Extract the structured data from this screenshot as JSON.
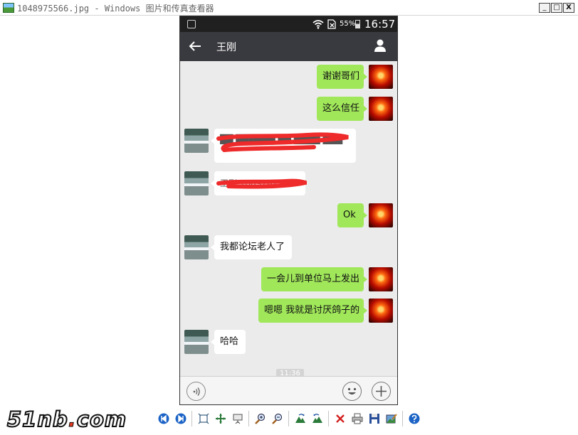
{
  "window": {
    "title": "1048975566.jpg - Windows 图片和传真查看器",
    "controls": {
      "minimize": "_",
      "maximize": "□",
      "close": "X"
    }
  },
  "phone": {
    "status": {
      "battery": "55%",
      "time": "16:57"
    },
    "chat_title": "王刚",
    "messages": [
      {
        "side": "self",
        "text": "谢谢哥们"
      },
      {
        "side": "self",
        "text": "这么信任"
      },
      {
        "side": "other",
        "text": "██ ██████ ██ ████ ███",
        "redacted": true
      },
      {
        "side": "other",
        "text": "王刚 18092621",
        "redacted": true
      },
      {
        "side": "self",
        "text": "Ok"
      },
      {
        "side": "other",
        "text": "我都论坛老人了"
      },
      {
        "side": "self",
        "text": "一会儿到单位马上发出"
      },
      {
        "side": "self",
        "text": "嗯嗯 我就是讨厌鸽子的"
      },
      {
        "side": "other",
        "text": "哈哈"
      }
    ],
    "timestamp": "11:36",
    "colors": {
      "self_bubble": "#a0e75a",
      "other_bubble": "#ffffff",
      "nav_bar": "#393a3f",
      "chat_bg": "#ebebeb"
    }
  },
  "watermark": {
    "brand": "51nb",
    "dot": ".",
    "domain": "com"
  }
}
